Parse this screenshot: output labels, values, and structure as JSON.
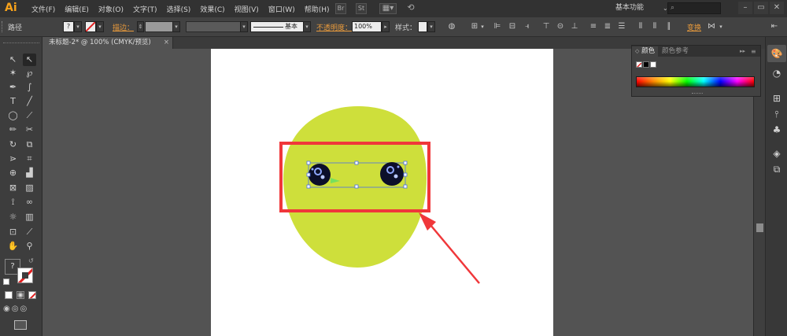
{
  "app": {
    "logo": "Ai"
  },
  "menu": {
    "items": [
      "文件(F)",
      "编辑(E)",
      "对象(O)",
      "文字(T)",
      "选择(S)",
      "效果(C)",
      "视图(V)",
      "窗口(W)",
      "帮助(H)"
    ],
    "br_label": "Br",
    "st_label": "St"
  },
  "workspace": {
    "label": "基本功能"
  },
  "control_bar": {
    "selection_type": "路径",
    "fill_label": "?",
    "stroke_label": "描边：",
    "stroke_style": "基本",
    "opacity_label": "不透明度：",
    "opacity_value": "100%",
    "style_label": "样式：",
    "transform_label": "变换"
  },
  "document": {
    "tab_title": "未标题-2* @ 100% (CMYK/预览)",
    "close": "×"
  },
  "color_panel": {
    "tab_color": "颜色",
    "tab_guide": "颜色参考"
  },
  "toolbox": {
    "fill_question": "?"
  },
  "colors": {
    "shape_fill": "#cedf3b",
    "annotation": "#f0373a",
    "selection": "#4a6ee8",
    "bg_dark": "#323232"
  },
  "icons": [
    "selection-tool-icon",
    "direct-selection-tool-icon",
    "magic-wand-icon",
    "lasso-icon",
    "pen-icon",
    "curvature-icon",
    "type-icon",
    "line-icon",
    "ellipse-icon",
    "brush-icon",
    "pencil-icon",
    "scissors-icon",
    "rotate-icon",
    "scale-icon",
    "width-icon",
    "free-transform-icon",
    "shape-builder-icon",
    "perspective-icon",
    "mesh-icon",
    "gradient-icon",
    "eyedropper-icon",
    "blend-icon",
    "symbol-sprayer-icon",
    "graph-icon",
    "artboard-icon",
    "slice-icon",
    "hand-icon",
    "zoom-icon"
  ]
}
